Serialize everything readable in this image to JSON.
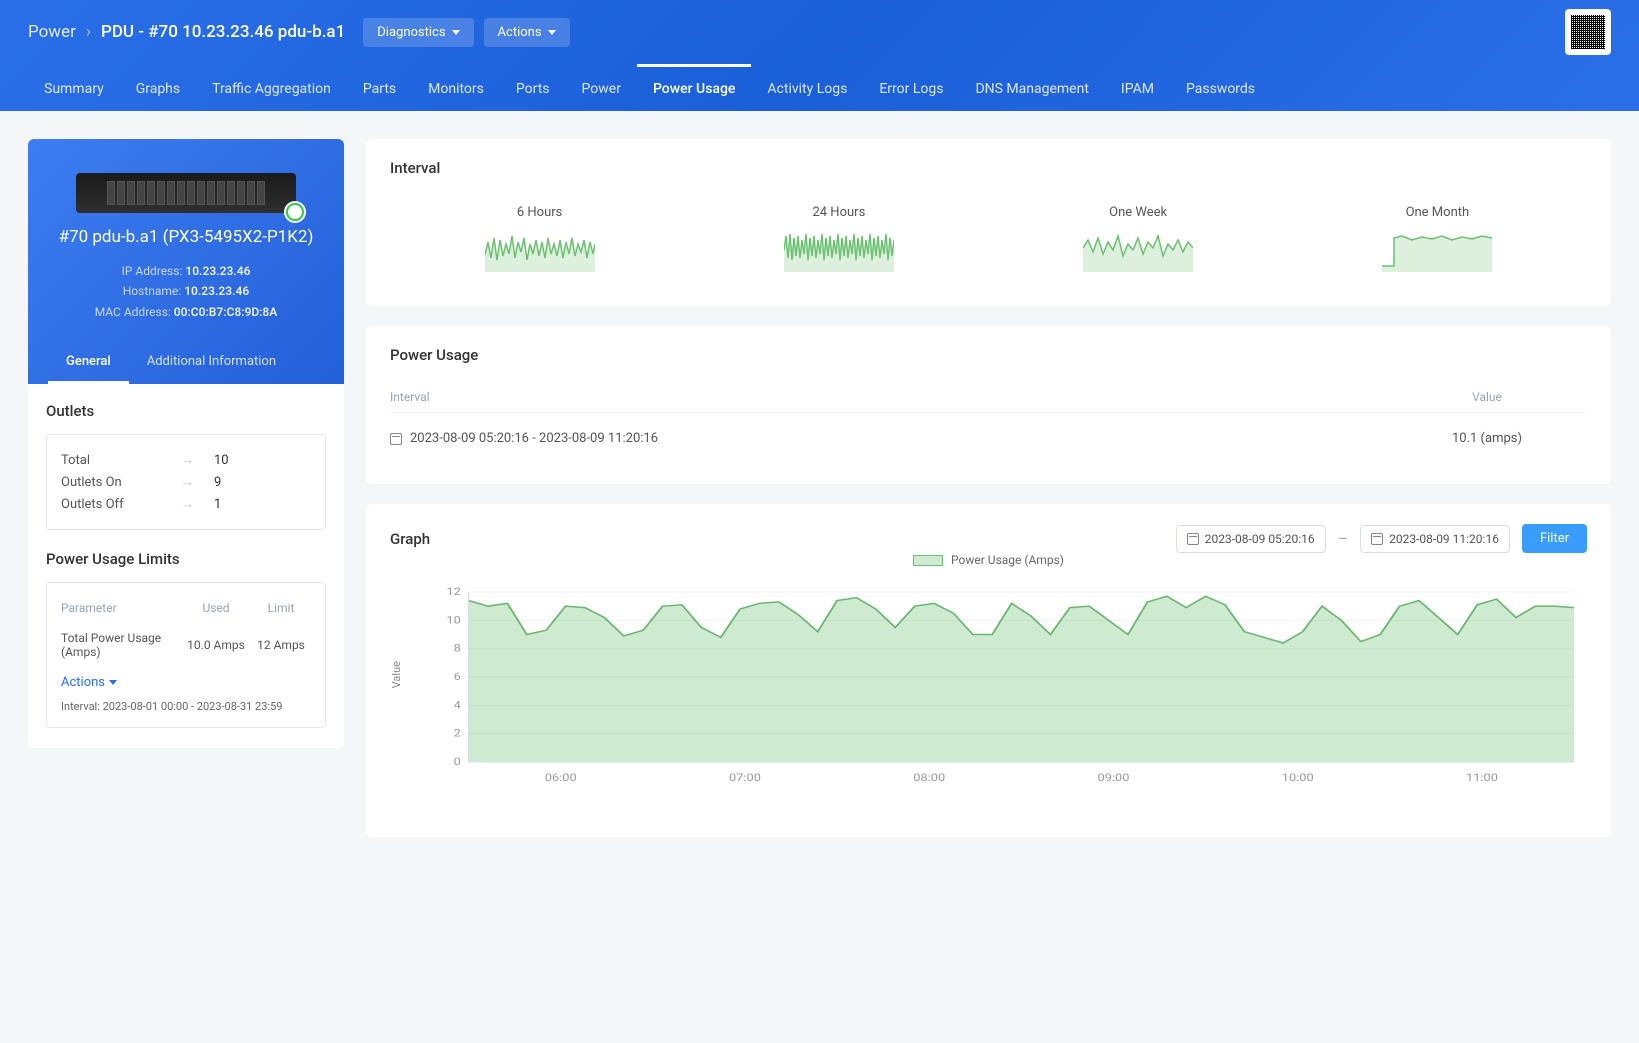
{
  "breadcrumb": {
    "root": "Power",
    "current": "PDU - #70 10.23.23.46 pdu-b.a1"
  },
  "topButtons": {
    "diagnostics": "Diagnostics",
    "actions": "Actions"
  },
  "tabs": [
    "Summary",
    "Graphs",
    "Traffic Aggregation",
    "Parts",
    "Monitors",
    "Ports",
    "Power",
    "Power Usage",
    "Activity Logs",
    "Error Logs",
    "DNS Management",
    "IPAM",
    "Passwords"
  ],
  "tabsActive": "Power Usage",
  "device": {
    "title": "#70 pdu-b.a1 (PX3-5495X2-P1K2)",
    "ip_label": "IP Address:",
    "ip": "10.23.23.46",
    "host_label": "Hostname:",
    "host": "10.23.23.46",
    "mac_label": "MAC Address:",
    "mac": "00:C0:B7:C8:9D:8A"
  },
  "heroTabs": {
    "general": "General",
    "additional": "Additional Information"
  },
  "outlets": {
    "heading": "Outlets",
    "rows": [
      {
        "label": "Total",
        "value": "10"
      },
      {
        "label": "Outlets On",
        "value": "9"
      },
      {
        "label": "Outlets Off",
        "value": "1"
      }
    ]
  },
  "limits": {
    "heading": "Power Usage Limits",
    "cols": {
      "c1": "Parameter",
      "c2": "Used",
      "c3": "Limit"
    },
    "row": {
      "param": "Total Power Usage (Amps)",
      "used": "10.0 Amps",
      "limit": "12 Amps"
    },
    "actions": "Actions",
    "interval_note": "Interval: 2023-08-01 00:00 - 2023-08-31 23:59"
  },
  "intervalPanel": {
    "heading": "Interval",
    "items": [
      "6 Hours",
      "24 Hours",
      "One Week",
      "One Month"
    ]
  },
  "powerUsage": {
    "heading": "Power Usage",
    "cols": {
      "c1": "Interval",
      "c2": "Value"
    },
    "row": {
      "interval": "2023-08-09 05:20:16 - 2023-08-09 11:20:16",
      "value": "10.1 (amps)"
    }
  },
  "graph": {
    "heading": "Graph",
    "from": "2023-08-09 05:20:16",
    "to": "2023-08-09 11:20:16",
    "filter": "Filter",
    "legend": "Power Usage (Amps)",
    "ylabel": "Value"
  },
  "chart_data": {
    "type": "area",
    "title": "Power Usage (Amps)",
    "xlabel": "",
    "ylabel": "Value",
    "ylim": [
      0,
      12
    ],
    "yticks": [
      0,
      2,
      4,
      6,
      8,
      10,
      12
    ],
    "xticks": [
      "06:00",
      "07:00",
      "08:00",
      "09:00",
      "10:00",
      "11:00"
    ],
    "series": [
      {
        "name": "Power Usage (Amps)",
        "values": [
          11.4,
          11.0,
          11.2,
          9.0,
          9.3,
          11.0,
          10.9,
          10.2,
          8.9,
          9.3,
          11.0,
          11.1,
          9.5,
          8.8,
          10.8,
          11.2,
          11.3,
          10.4,
          9.2,
          11.4,
          11.6,
          10.8,
          9.5,
          11.0,
          11.2,
          10.5,
          9.0,
          9.0,
          11.2,
          10.3,
          9.0,
          10.9,
          11.0,
          10.0,
          9.0,
          11.3,
          11.7,
          10.9,
          11.7,
          11.1,
          9.2,
          8.8,
          8.4,
          9.2,
          11.0,
          10.0,
          8.5,
          9.0,
          11.0,
          11.4,
          10.2,
          9.0,
          11.1,
          11.5,
          10.2,
          11.0,
          11.0,
          10.9
        ]
      }
    ]
  }
}
